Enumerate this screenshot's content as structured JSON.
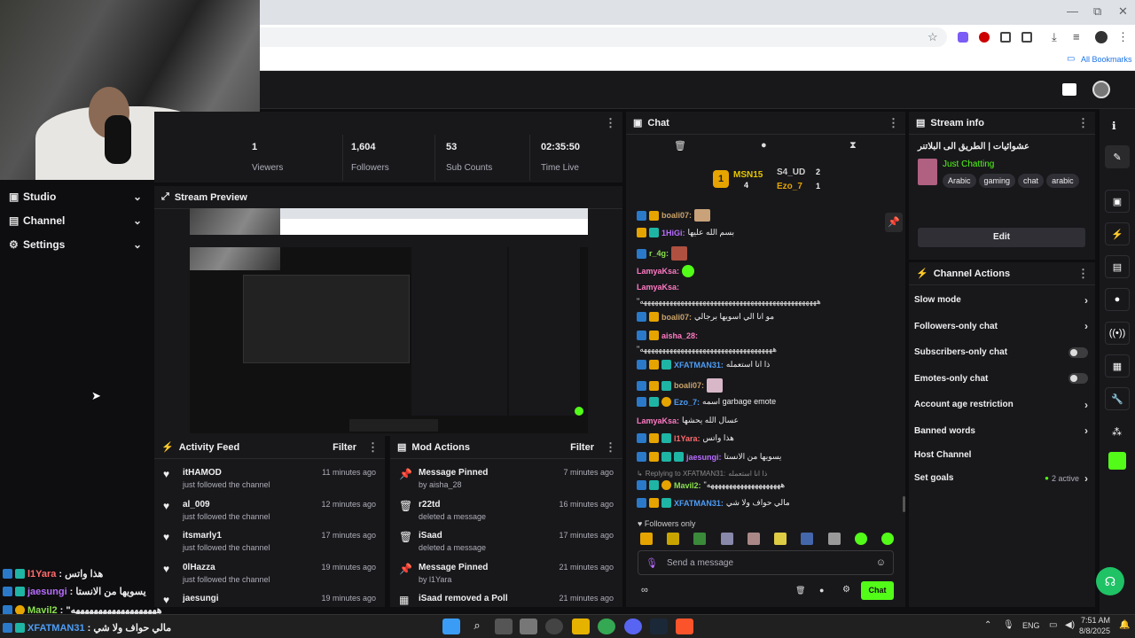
{
  "browser": {
    "bookmarks_label": "All Bookmarks",
    "controls": {
      "minimize": "—",
      "restore": "⧉",
      "close": "✕"
    }
  },
  "sidebar": {
    "items": [
      {
        "label": "Studio",
        "icon": "studio-icon"
      },
      {
        "label": "Channel",
        "icon": "channel-icon"
      },
      {
        "label": "Settings",
        "icon": "gear-icon"
      }
    ]
  },
  "stats": [
    {
      "value": "1",
      "label": "Viewers"
    },
    {
      "value": "1,604",
      "label": "Followers"
    },
    {
      "value": "53",
      "label": "Sub Counts"
    },
    {
      "value": "02:35:50",
      "label": "Time Live"
    }
  ],
  "preview": {
    "title": "Stream Preview"
  },
  "activity_feed": {
    "title": "Activity Feed",
    "filter_label": "Filter",
    "items": [
      {
        "name": "itHAMOD",
        "detail": "just followed the channel",
        "time": "11 minutes ago"
      },
      {
        "name": "al_009",
        "detail": "just followed the channel",
        "time": "12 minutes ago"
      },
      {
        "name": "itsmarly1",
        "detail": "just followed the channel",
        "time": "17 minutes ago"
      },
      {
        "name": "0lHazza",
        "detail": "just followed the channel",
        "time": "19 minutes ago"
      },
      {
        "name": "jaesungi",
        "detail": "",
        "time": "19 minutes ago"
      }
    ]
  },
  "mod_actions": {
    "title": "Mod Actions",
    "filter_label": "Filter",
    "items": [
      {
        "name": "Message Pinned",
        "detail": "by aisha_28",
        "time": "7 minutes ago",
        "icon": "pin-icon"
      },
      {
        "name": "r22td",
        "detail": "deleted a message",
        "time": "16 minutes ago",
        "icon": "trash-icon"
      },
      {
        "name": "iSaad",
        "detail": "deleted a message",
        "time": "17 minutes ago",
        "icon": "trash-icon"
      },
      {
        "name": "Message Pinned",
        "detail": "by l1Yara",
        "time": "21 minutes ago",
        "icon": "pin-icon"
      },
      {
        "name": "iSaad removed a Poll",
        "detail": "",
        "time": "21 minutes ago",
        "icon": "poll-icon"
      }
    ]
  },
  "chat": {
    "title": "Chat",
    "leaderboard": [
      {
        "name": "MSN15",
        "count": "4"
      },
      {
        "name": "S4_UD",
        "count": "2"
      },
      {
        "name": "Ezo_7",
        "count": "1"
      }
    ],
    "messages": [
      {
        "user": "boali07:",
        "text": "",
        "cls": "n-g"
      },
      {
        "user": "1HiGi:",
        "text": "بسم الله عليها",
        "cls": "n-v"
      },
      {
        "user": "r_4g:",
        "text": "",
        "cls": "n-gr"
      },
      {
        "user": "LamyaKsa:",
        "text": "",
        "cls": "n-p"
      },
      {
        "user": "LamyaKsa:",
        "text": "",
        "cls": "n-p"
      },
      {
        "user": "",
        "text": "\"ههههههههههههههههههههههههههههههههههههههههههههههههه",
        "cls": ""
      },
      {
        "user": "boali07:",
        "text": "مو انا الي اسويها برجالي",
        "cls": "n-g"
      },
      {
        "user": "aisha_28:",
        "text": "",
        "cls": "n-p"
      },
      {
        "user": "",
        "text": "\"ههههههههههههههههههههههههههههههههههههه",
        "cls": ""
      },
      {
        "user": "XFATMAN31:",
        "text": "ذا انا استعمله",
        "cls": "n-b"
      },
      {
        "user": "boali07:",
        "text": "",
        "cls": "n-g"
      },
      {
        "user": "Ezo_7:",
        "text": "اسمه garbage emote",
        "cls": "n-b"
      },
      {
        "user": "LamyaKsa:",
        "text": "عسال الله يحشها",
        "cls": "n-p"
      },
      {
        "user": "l1Yara:",
        "text": "هذا واتس",
        "cls": "n-o"
      },
      {
        "user": "jaesungi:",
        "text": "يسويها من الانستا",
        "cls": "n-v"
      },
      {
        "user": "Replying to XFATMAN31:",
        "text": "ذا انا استعمله",
        "cls": ""
      },
      {
        "user": "Mavil2:",
        "text": "\"ههههههههههههههههههههه",
        "cls": "n-gr"
      },
      {
        "user": "XFATMAN31:",
        "text": "مالي حواف ولا شي",
        "cls": "n-b"
      }
    ],
    "followers_only": "Followers only",
    "input_placeholder": "Send a message",
    "send_label": "Chat"
  },
  "stream_info": {
    "title": "Stream info",
    "stream_title": "عشوائيات | الطريق الى البلاتنر",
    "category": "Just Chatting",
    "tags": [
      "Arabic",
      "gaming",
      "chat",
      "arabic"
    ],
    "edit_label": "Edit"
  },
  "channel_actions": {
    "title": "Channel Actions",
    "items": [
      {
        "label": "Slow mode",
        "control": "chevron"
      },
      {
        "label": "Followers-only chat",
        "control": "chevron"
      },
      {
        "label": "Subscribers-only chat",
        "control": "toggle"
      },
      {
        "label": "Emotes-only chat",
        "control": "toggle"
      },
      {
        "label": "Account age restriction",
        "control": "chevron"
      },
      {
        "label": "Banned words",
        "control": "chevron"
      },
      {
        "label": "Host Channel",
        "control": "none"
      },
      {
        "label": "Set goals",
        "control": "chevron",
        "status": "2 active"
      }
    ]
  },
  "overlay_chat": [
    {
      "user": "l1Yara",
      "text": ": هذا واتس",
      "cls": "n-o"
    },
    {
      "user": "jaesungi",
      "text": ": يسويها من الانستا",
      "cls": "n-v"
    },
    {
      "user": "Mavil2",
      "text": ": \"هههههههههههههههههههه",
      "cls": "n-gr"
    },
    {
      "user": "XFATMAN31",
      "text": ": مالي حواف ولا شي",
      "cls": "n-b"
    }
  ],
  "taskbar": {
    "lang": "ENG",
    "time": "7:51 AM",
    "date": "8/8/2025"
  },
  "colors": {
    "accent": "#53fc18",
    "panel": "#18181b",
    "background": "#0e0e10"
  }
}
